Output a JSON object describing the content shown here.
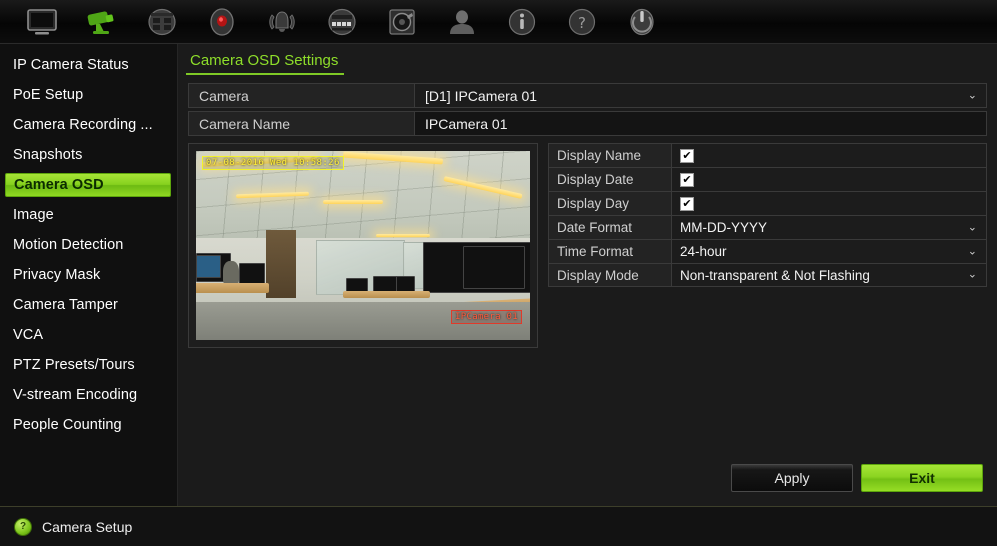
{
  "toolbar": {
    "items": [
      {
        "name": "live-view-icon",
        "label": "Live View",
        "active": false
      },
      {
        "name": "camera-setup-icon",
        "label": "Camera Setup",
        "active": true
      },
      {
        "name": "network-settings-icon",
        "label": "Network Settings",
        "active": false
      },
      {
        "name": "recording-icon",
        "label": "Recording",
        "active": false
      },
      {
        "name": "alarm-icon",
        "label": "Alarm",
        "active": false
      },
      {
        "name": "system-settings-icon",
        "label": "System Settings",
        "active": false
      },
      {
        "name": "hard-disk-icon",
        "label": "HDD Management",
        "active": false
      },
      {
        "name": "user-management-icon",
        "label": "User Management",
        "active": false
      },
      {
        "name": "system-info-icon",
        "label": "System Info",
        "active": false
      },
      {
        "name": "help-icon",
        "label": "Help",
        "active": false
      },
      {
        "name": "shutdown-icon",
        "label": "Shutdown",
        "active": false
      }
    ]
  },
  "sidebar": {
    "items": [
      {
        "label": "IP Camera Status",
        "active": false
      },
      {
        "label": "PoE Setup",
        "active": false
      },
      {
        "label": "Camera Recording ...",
        "active": false
      },
      {
        "label": "Snapshots",
        "active": false
      },
      {
        "label": "Camera OSD",
        "active": true
      },
      {
        "label": "Image",
        "active": false
      },
      {
        "label": "Motion Detection",
        "active": false
      },
      {
        "label": "Privacy Mask",
        "active": false
      },
      {
        "label": "Camera Tamper",
        "active": false
      },
      {
        "label": "VCA",
        "active": false
      },
      {
        "label": "PTZ Presets/Tours",
        "active": false
      },
      {
        "label": "V-stream Encoding",
        "active": false
      },
      {
        "label": "People Counting",
        "active": false
      }
    ]
  },
  "main": {
    "page_title": "Camera OSD Settings",
    "camera_row": {
      "label": "Camera",
      "value": "[D1] IPCamera 01",
      "chevron": "⌄"
    },
    "camera_name_row": {
      "label": "Camera Name",
      "value": "IPCamera 01"
    },
    "preview": {
      "osd_timestamp": "07-08-2016 Wed 10:58:26",
      "osd_camera_name": "IPCamera 01"
    },
    "settings": [
      {
        "label": "Display Name",
        "type": "checkbox",
        "checked": true,
        "check_glyph": "✔"
      },
      {
        "label": "Display Date",
        "type": "checkbox",
        "checked": true,
        "check_glyph": "✔"
      },
      {
        "label": "Display Day",
        "type": "checkbox",
        "checked": true,
        "check_glyph": "✔"
      },
      {
        "label": "Date Format",
        "type": "select",
        "value": "MM-DD-YYYY",
        "chevron": "⌄"
      },
      {
        "label": "Time Format",
        "type": "select",
        "value": "24-hour",
        "chevron": "⌄"
      },
      {
        "label": "Display Mode",
        "type": "select",
        "value": "Non-transparent & Not Flashing",
        "chevron": "⌄"
      }
    ],
    "buttons": {
      "apply": "Apply",
      "exit": "Exit"
    }
  },
  "statusbar": {
    "icon_glyph": "?",
    "text": "Camera Setup"
  },
  "colors": {
    "accent_green": "#8bd421",
    "title_green": "#8ede2a",
    "panel_bg": "#1b1b1b",
    "sidebar_bg": "#101010",
    "osd_yellow": "#ffef3a",
    "osd_red": "#ff5a3c"
  }
}
